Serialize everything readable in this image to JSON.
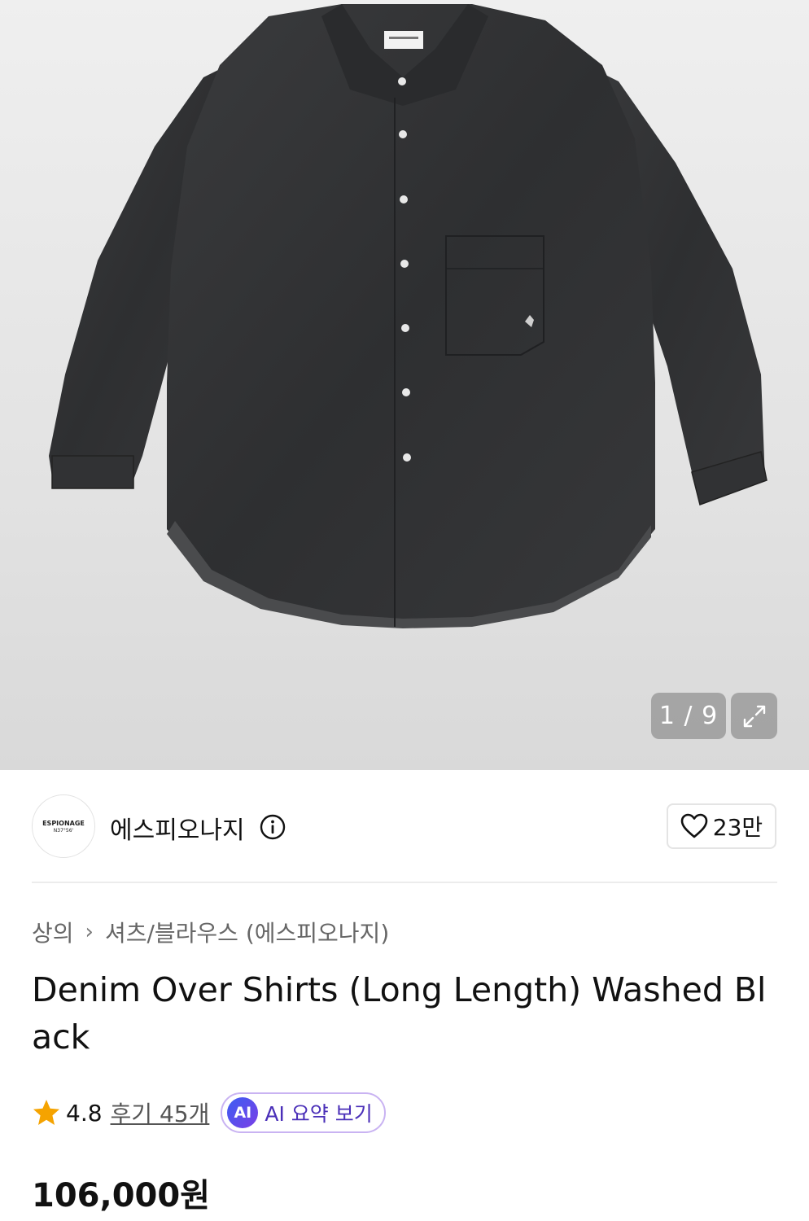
{
  "gallery": {
    "image_alt": "Denim Over Shirts (Long Length) Washed Black product photo",
    "counter": "1 / 9",
    "expand_icon": "expand-icon"
  },
  "brand": {
    "logo_line1": "ESPIONAGE",
    "logo_line2": "N37°56'",
    "name": "에스피오나지",
    "info_icon": "info-icon"
  },
  "like": {
    "icon": "heart-icon",
    "count": "23만"
  },
  "breadcrumb": {
    "level1": "상의",
    "separator_icon": "chevron-right-icon",
    "level2": "셔츠/블라우스 (에스피오나지)"
  },
  "product": {
    "title": "Denim Over Shirts (Long Length) Washed Black"
  },
  "rating": {
    "icon": "star-icon",
    "score": "4.8",
    "reviews": "후기 45개",
    "star_color": "#f5a300"
  },
  "ai_summary": {
    "badge": "AI",
    "label": "AI 요약 보기"
  },
  "price": "106,000원"
}
